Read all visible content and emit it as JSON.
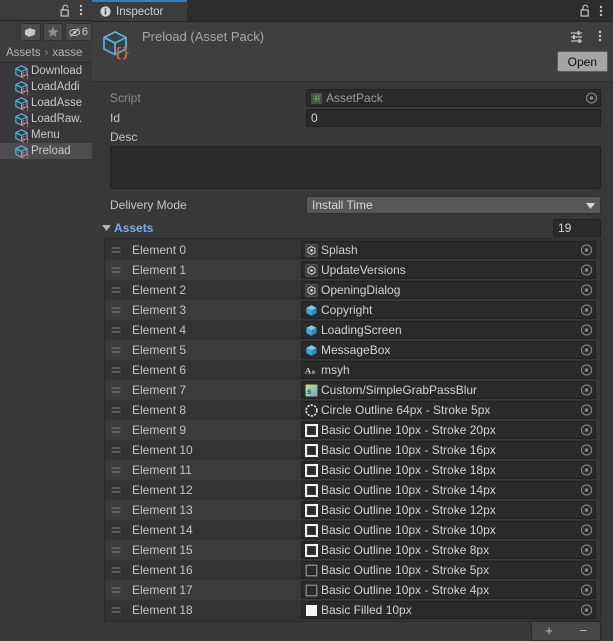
{
  "project_panel": {
    "toolbar": {
      "lock_icon": "lock-open-icon",
      "menu_icon": "kebab-menu-icon",
      "tag_label": "",
      "tag_icon": "label-tag-icon",
      "favorite_icon": "star-icon",
      "hidden_icon": "eye-crossed-icon",
      "hidden_count": "6"
    },
    "breadcrumb": {
      "root": "Assets",
      "separator": "›",
      "current": "xasse"
    },
    "tree_items": [
      {
        "label": "Download",
        "icon": "asset-pack-icon",
        "selected": false
      },
      {
        "label": "LoadAddi",
        "icon": "asset-pack-icon",
        "selected": false
      },
      {
        "label": "LoadAsse",
        "icon": "asset-pack-icon",
        "selected": false
      },
      {
        "label": "LoadRaw.",
        "icon": "asset-pack-icon",
        "selected": false
      },
      {
        "label": "Menu",
        "icon": "asset-pack-icon",
        "selected": false
      },
      {
        "label": "Preload",
        "icon": "asset-pack-icon",
        "selected": true
      }
    ]
  },
  "inspector": {
    "tab_label": "Inspector",
    "tab_icon": "info-icon",
    "lock_icon": "lock-open-icon",
    "menu_icon": "kebab-menu-icon",
    "header": {
      "title": "Preload (Asset Pack)",
      "icon": "asset-pack-icon",
      "preset_icon": "preset-sliders-icon",
      "menu_icon": "kebab-menu-icon",
      "open_label": "Open"
    },
    "fields": {
      "script_label": "Script",
      "script_value": "AssetPack",
      "script_icon": "cs-script-icon",
      "id_label": "Id",
      "id_value": "0",
      "desc_label": "Desc",
      "desc_value": "",
      "delivery_mode_label": "Delivery Mode",
      "delivery_mode_value": "Install Time"
    },
    "assets": {
      "title": "Assets",
      "count": "19",
      "foldout_icon": "triangle-down-icon",
      "add_label": "+",
      "remove_label": "−",
      "elements": [
        {
          "label": "Element 0",
          "value": "Splash",
          "icon": "scene-icon"
        },
        {
          "label": "Element 1",
          "value": "UpdateVersions",
          "icon": "scene-icon"
        },
        {
          "label": "Element 2",
          "value": "OpeningDialog",
          "icon": "scene-icon"
        },
        {
          "label": "Element 3",
          "value": "Copyright",
          "icon": "prefab-icon"
        },
        {
          "label": "Element 4",
          "value": "LoadingScreen",
          "icon": "prefab-icon"
        },
        {
          "label": "Element 5",
          "value": "MessageBox",
          "icon": "prefab-icon"
        },
        {
          "label": "Element 6",
          "value": "msyh",
          "icon": "font-icon"
        },
        {
          "label": "Element 7",
          "value": "Custom/SimpleGrabPassBlur",
          "icon": "shader-icon"
        },
        {
          "label": "Element 8",
          "value": "Circle Outline 64px - Stroke 5px",
          "icon": "sprite-circle-icon"
        },
        {
          "label": "Element 9",
          "value": "Basic Outline 10px - Stroke 20px",
          "icon": "sprite-square-icon"
        },
        {
          "label": "Element 10",
          "value": "Basic Outline 10px - Stroke 16px",
          "icon": "sprite-square-icon"
        },
        {
          "label": "Element 11",
          "value": "Basic Outline 10px - Stroke 18px",
          "icon": "sprite-square-icon"
        },
        {
          "label": "Element 12",
          "value": "Basic Outline 10px - Stroke 14px",
          "icon": "sprite-square-icon"
        },
        {
          "label": "Element 13",
          "value": "Basic Outline 10px - Stroke 12px",
          "icon": "sprite-square-icon"
        },
        {
          "label": "Element 14",
          "value": "Basic Outline 10px - Stroke 10px",
          "icon": "sprite-square-icon"
        },
        {
          "label": "Element 15",
          "value": "Basic Outline 10px - Stroke 8px",
          "icon": "sprite-square-icon"
        },
        {
          "label": "Element 16",
          "value": "Basic Outline 10px - Stroke 5px",
          "icon": "sprite-square-thin-icon"
        },
        {
          "label": "Element 17",
          "value": "Basic Outline 10px - Stroke 4px",
          "icon": "sprite-square-thin-icon"
        },
        {
          "label": "Element 18",
          "value": "Basic Filled 10px",
          "icon": "sprite-filled-icon"
        }
      ]
    }
  },
  "colors": {
    "accent_blue": "#3b7ec0",
    "foldout_blue": "#7baaf0",
    "window_bg": "#383838",
    "field_bg": "#2a2a2a",
    "cube_blue": "#4fb8e8",
    "brace_orange": "#e8603c"
  }
}
